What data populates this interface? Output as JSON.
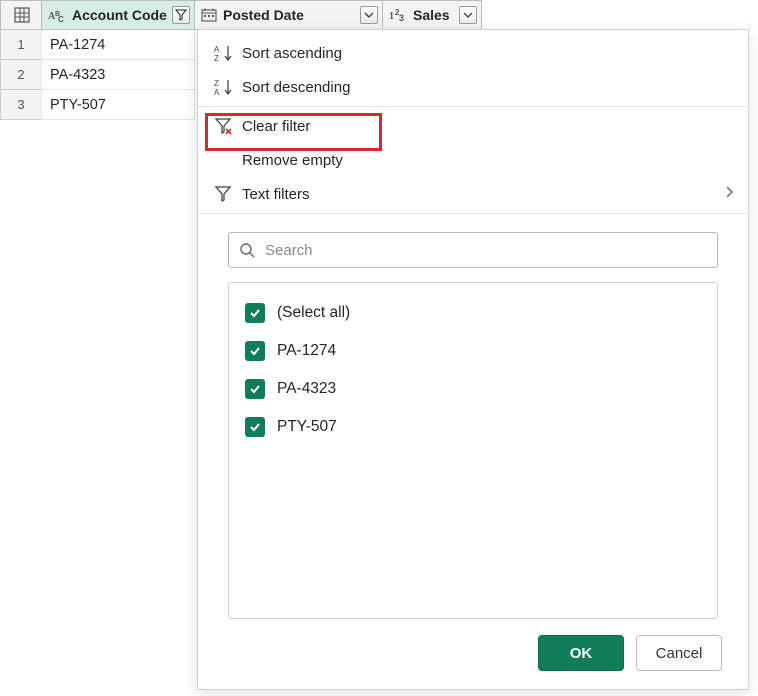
{
  "columns": {
    "account": {
      "label": "Account Code"
    },
    "posted": {
      "label": "Posted Date"
    },
    "sales": {
      "label": "Sales"
    }
  },
  "rows": [
    {
      "n": "1",
      "account": "PA-1274"
    },
    {
      "n": "2",
      "account": "PA-4323"
    },
    {
      "n": "3",
      "account": "PTY-507"
    }
  ],
  "menu": {
    "sort_asc": "Sort ascending",
    "sort_desc": "Sort descending",
    "clear": "Clear filter",
    "remove": "Remove empty",
    "text_filt": "Text filters"
  },
  "search": {
    "placeholder": "Search"
  },
  "options": {
    "select_all": "(Select all)",
    "items": [
      "PA-1274",
      "PA-4323",
      "PTY-507"
    ]
  },
  "buttons": {
    "ok": "OK",
    "cancel": "Cancel"
  }
}
